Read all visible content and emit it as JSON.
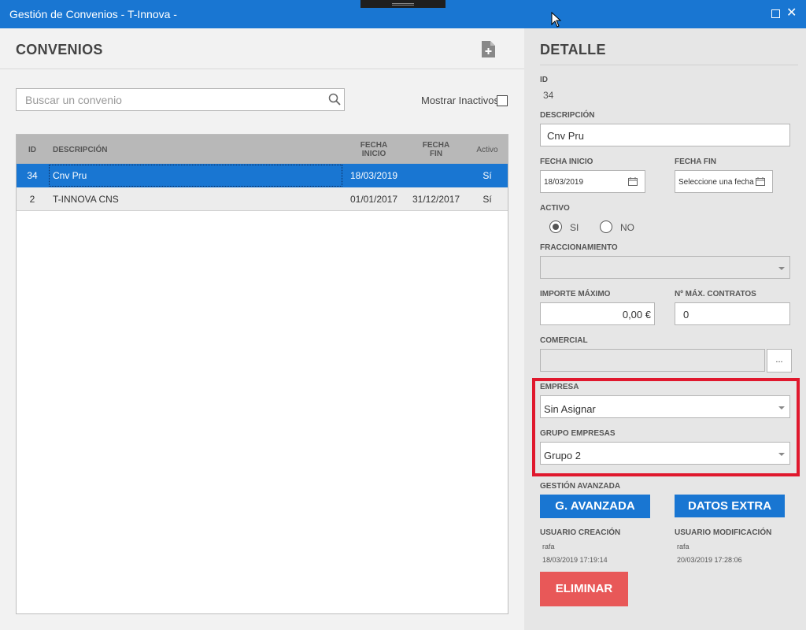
{
  "window": {
    "title": "Gestión de Convenios - T-Innova  -"
  },
  "list": {
    "title": "CONVENIOS",
    "search_placeholder": "Buscar un convenio",
    "inactive_label": "Mostrar Inactivos",
    "inactive_checked": false,
    "columns": {
      "id": "ID",
      "descripcion": "DESCRIPCIÓN",
      "fecha_inicio_1": "FECHA",
      "fecha_inicio_2": "INICIO",
      "fecha_fin_1": "FECHA",
      "fecha_fin_2": "FIN",
      "activo": "Activo"
    },
    "rows": [
      {
        "id": "34",
        "descripcion": "Cnv Pru",
        "inicio": "18/03/2019",
        "fin": "",
        "activo": "Sí",
        "selected": true
      },
      {
        "id": "2",
        "descripcion": "T-INNOVA CNS",
        "inicio": "01/01/2017",
        "fin": "31/12/2017",
        "activo": "Sí",
        "selected": false
      }
    ]
  },
  "detail": {
    "title": "DETALLE",
    "id_label": "ID",
    "id_value": "34",
    "descripcion_label": "DESCRIPCIÓN",
    "descripcion_value": "Cnv Pru",
    "fecha_inicio_label": "FECHA INICIO",
    "fecha_inicio_value": "18/03/2019",
    "fecha_fin_label": "FECHA FIN",
    "fecha_fin_placeholder": "Seleccione una fecha",
    "activo_label": "ACTIVO",
    "activo_si": "SI",
    "activo_no": "NO",
    "activo_selected": "SI",
    "fraccionamiento_label": "FRACCIONAMIENTO",
    "fraccionamiento_value": "",
    "importe_label": "IMPORTE MÁXIMO",
    "importe_value": "0,00 €",
    "contratos_label": "Nº MÁX. CONTRATOS",
    "contratos_value": "0",
    "comercial_label": "COMERCIAL",
    "comercial_value": "",
    "comercial_button": "...",
    "empresa_label": "EMPRESA",
    "empresa_value": "Sin Asignar",
    "grupo_label": "GRUPO EMPRESAS",
    "grupo_value": "Grupo 2",
    "avanzada_label": "GESTIÓN AVANZADA",
    "avanzada_button": "G. AVANZADA",
    "extra_button": "DATOS EXTRA",
    "usuario_creacion_label": "USUARIO CREACIÓN",
    "usuario_creacion_user": "rafa",
    "usuario_creacion_date": "18/03/2019 17:19:14",
    "usuario_mod_label": "USUARIO MODIFICACIÓN",
    "usuario_mod_user": "rafa",
    "usuario_mod_date": "20/03/2019 17:28:06",
    "eliminar_button": "ELIMINAR"
  },
  "colors": {
    "accent": "#1976d2",
    "danger": "#e85858",
    "highlight": "#e0182d"
  }
}
